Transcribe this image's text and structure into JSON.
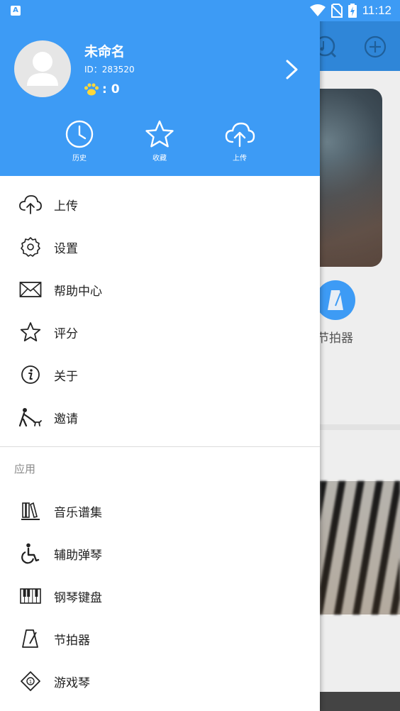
{
  "status": {
    "time": "11:12",
    "app_icon_letter": "A"
  },
  "profile": {
    "name": "未命名",
    "id_text": "ID：283520",
    "points_text": ": 0"
  },
  "quick_actions": [
    {
      "label": "历史",
      "icon": "clock-icon"
    },
    {
      "label": "收藏",
      "icon": "star-icon"
    },
    {
      "label": "上传",
      "icon": "upload-cloud-icon"
    }
  ],
  "menu": [
    {
      "label": "上传",
      "icon": "upload-cloud-icon"
    },
    {
      "label": "设置",
      "icon": "gear-icon"
    },
    {
      "label": "帮助中心",
      "icon": "mail-icon"
    },
    {
      "label": "评分",
      "icon": "star-icon"
    },
    {
      "label": "关于",
      "icon": "info-icon"
    },
    {
      "label": "邀请",
      "icon": "person-walking-dog-icon"
    }
  ],
  "apps_section": {
    "title": "应用",
    "items": [
      {
        "label": "音乐谱集",
        "icon": "books-icon"
      },
      {
        "label": "辅助弹琴",
        "icon": "wheelchair-icon"
      },
      {
        "label": "钢琴键盘",
        "icon": "piano-keys-icon"
      },
      {
        "label": "节拍器",
        "icon": "metronome-icon"
      },
      {
        "label": "游戏琴",
        "icon": "game-diamond-icon"
      }
    ]
  },
  "background": {
    "metronome_label": "节拍器"
  },
  "colors": {
    "accent": "#3d9bf5",
    "text": "#222222",
    "muted": "#8a8a8a"
  }
}
